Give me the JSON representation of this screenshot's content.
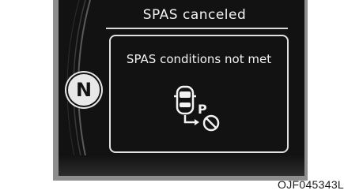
{
  "display": {
    "title": "SPAS canceled",
    "message": "SPAS conditions not met",
    "gear_indicator": "N",
    "icons": [
      "gauge-arc-icon",
      "car-parking-prohibited-icon"
    ]
  },
  "figure_code": "OJF045343L",
  "colors": {
    "frame": "#8e8e8e",
    "screen": "#121212",
    "text": "#f2f2f2"
  }
}
